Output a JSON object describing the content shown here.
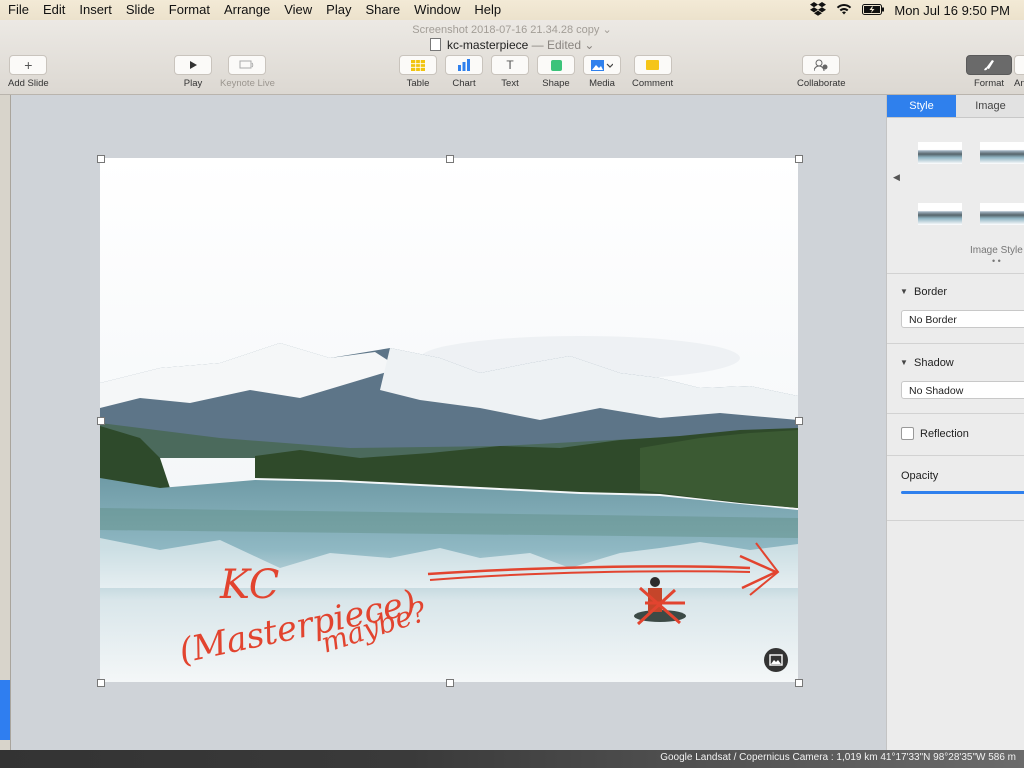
{
  "menubar": {
    "items": [
      "File",
      "Edit",
      "Insert",
      "Slide",
      "Format",
      "Arrange",
      "View",
      "Play",
      "Share",
      "Window",
      "Help"
    ],
    "datetime": "Mon Jul 16  9:50 PM"
  },
  "window": {
    "screenshot_title": "Screenshot 2018-07-16 21.34.28 copy",
    "doc_name": "kc-masterpiece",
    "doc_status": "— Edited"
  },
  "toolbar": {
    "add_slide": "Add Slide",
    "play": "Play",
    "keynote_live": "Keynote Live",
    "table": "Table",
    "chart": "Chart",
    "text": "Text",
    "shape": "Shape",
    "media": "Media",
    "comment": "Comment",
    "collaborate": "Collaborate",
    "format": "Format",
    "animate": "An"
  },
  "inspector": {
    "tabs": [
      "Style",
      "Image"
    ],
    "image_styles_label": "Image Style",
    "border_label": "Border",
    "border_value": "No Border",
    "shadow_label": "Shadow",
    "shadow_value": "No Shadow",
    "reflection_label": "Reflection",
    "opacity_label": "Opacity"
  },
  "slide": {
    "annotation_line1": "KC",
    "annotation_line2": "(Masterpiece)",
    "annotation_line3": "maybe?"
  },
  "map_attribution": "Google  Landsat / Copernicus    Camera : 1,019 km   41°17'33\"N 98°28'35\"W    586 m",
  "colors": {
    "accent": "#2f80ed",
    "annotation_red": "#e2442f"
  }
}
